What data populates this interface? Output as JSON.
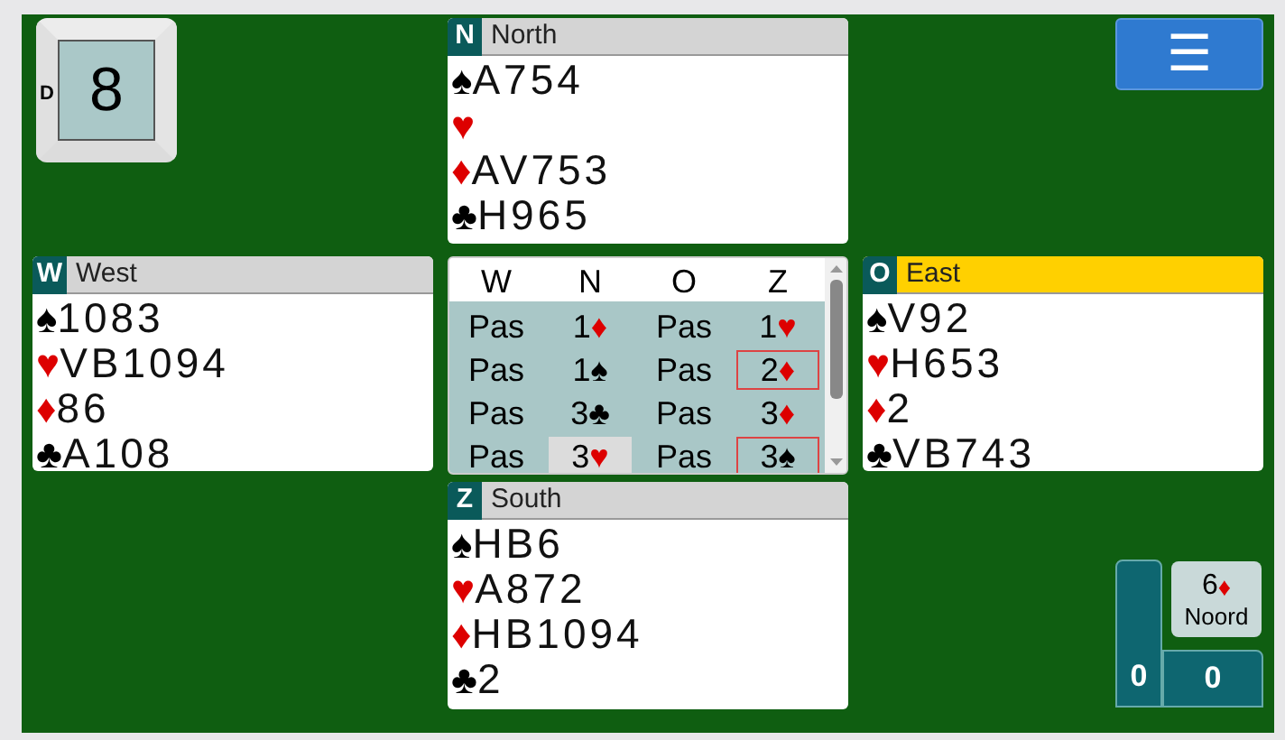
{
  "board": {
    "dealer": "D",
    "number": "8"
  },
  "menu_button": {
    "label": "☰"
  },
  "hands": [
    {
      "seat": "N",
      "name": "North",
      "selected": false,
      "suits": [
        {
          "symbol": "♠",
          "color": "#000000",
          "cards": "A754"
        },
        {
          "symbol": "♥",
          "color": "#dd0000"
        },
        {
          "symbol": "♦",
          "color": "#dd0000",
          "cards": "AV753"
        },
        {
          "symbol": "♣",
          "color": "#000000",
          "cards": "H965"
        }
      ]
    },
    {
      "seat": "W",
      "name": "West",
      "selected": false,
      "suits": [
        {
          "symbol": "♠",
          "color": "#000000",
          "cards": "1083"
        },
        {
          "symbol": "♥",
          "color": "#dd0000",
          "cards": "VB1094"
        },
        {
          "symbol": "♦",
          "color": "#dd0000",
          "cards": "86"
        },
        {
          "symbol": "♣",
          "color": "#000000",
          "cards": "A108"
        }
      ]
    },
    {
      "seat": "O",
      "name": "East",
      "selected": true,
      "suits": [
        {
          "symbol": "♠",
          "color": "#000000",
          "cards": "V92"
        },
        {
          "symbol": "♥",
          "color": "#dd0000",
          "cards": "H653"
        },
        {
          "symbol": "♦",
          "color": "#dd0000",
          "cards": "2"
        },
        {
          "symbol": "♣",
          "color": "#000000",
          "cards": "VB743"
        }
      ]
    },
    {
      "seat": "Z",
      "name": "South",
      "selected": false,
      "suits": [
        {
          "symbol": "♠",
          "color": "#000000",
          "cards": "HB6"
        },
        {
          "symbol": "♥",
          "color": "#dd0000",
          "cards": "A872"
        },
        {
          "symbol": "♦",
          "color": "#dd0000",
          "cards": "HB1094"
        },
        {
          "symbol": "♣",
          "color": "#000000",
          "cards": "2"
        }
      ]
    }
  ],
  "bidding": {
    "columns": [
      "W",
      "N",
      "O",
      "Z"
    ],
    "rows": [
      [
        {
          "text": "Pas",
          "selected": false,
          "marked": false
        },
        {
          "text": "1",
          "suit": "♦",
          "color": "#dd0000",
          "selected": false,
          "marked": false
        },
        {
          "text": "Pas",
          "selected": false,
          "marked": false
        },
        {
          "text": "1",
          "suit": "♥",
          "color": "#dd0000",
          "selected": false,
          "marked": false
        }
      ],
      [
        {
          "text": "Pas",
          "selected": false,
          "marked": false
        },
        {
          "text": "1",
          "suit": "♠",
          "color": "#000000",
          "selected": false,
          "marked": false
        },
        {
          "text": "Pas",
          "selected": false,
          "marked": false
        },
        {
          "text": "2",
          "suit": "♦",
          "color": "#dd0000",
          "selected": false,
          "marked": true
        }
      ],
      [
        {
          "text": "Pas",
          "selected": false,
          "marked": false
        },
        {
          "text": "3",
          "suit": "♣",
          "color": "#000000",
          "selected": false,
          "marked": false
        },
        {
          "text": "Pas",
          "selected": false,
          "marked": false
        },
        {
          "text": "3",
          "suit": "♦",
          "color": "#dd0000",
          "selected": false,
          "marked": false
        }
      ],
      [
        {
          "text": "Pas",
          "selected": false,
          "marked": false
        },
        {
          "text": "3",
          "suit": "♥",
          "color": "#dd0000",
          "selected": true,
          "marked": false
        },
        {
          "text": "Pas",
          "selected": false,
          "marked": false
        },
        {
          "text": "3",
          "suit": "♠",
          "color": "#000000",
          "selected": false,
          "marked": true
        }
      ]
    ]
  },
  "contract": {
    "level_text": "6",
    "suit": "♦",
    "color": "#dd0000",
    "declarer": "Noord"
  },
  "scores": [
    "0",
    "0"
  ]
}
